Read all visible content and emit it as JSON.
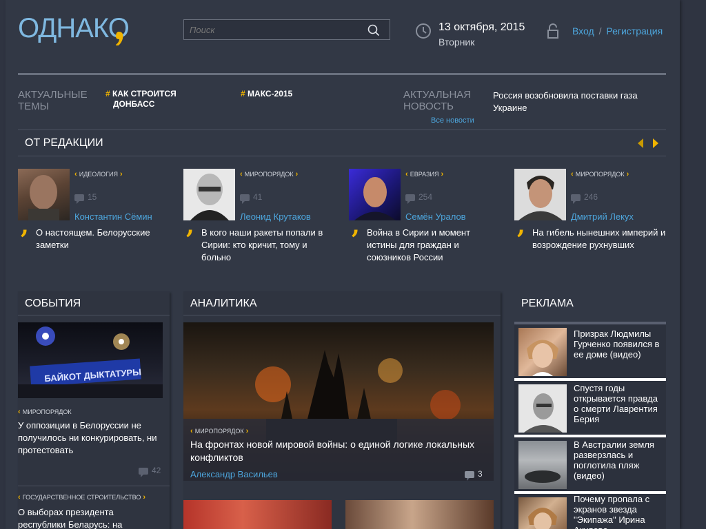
{
  "header": {
    "logo_text": "ОДНАКО",
    "search_placeholder": "Поиск",
    "date": "13 октября, 2015",
    "weekday": "Вторник",
    "login": "Вход",
    "separator": "/",
    "register": "Регистрация"
  },
  "topics": {
    "label_line1": "АКТУАЛЬНЫЕ",
    "label_line2": "ТЕМЫ",
    "items": [
      {
        "hash": "#",
        "line1": "КАК СТРОИТСЯ",
        "line2": "ДОНБАСС"
      },
      {
        "hash": "#",
        "line1": "МАКС-2015",
        "line2": ""
      }
    ]
  },
  "news": {
    "label_line1": "АКТУАЛЬНАЯ",
    "label_line2": "НОВОСТЬ",
    "text": "Россия возобновила поставки газа Украине",
    "all_news": "Все новости"
  },
  "editorial": {
    "title": "ОТ РЕДАКЦИИ",
    "cards": [
      {
        "tag": "ИДЕОЛОГИЯ",
        "comments": "15",
        "author": "Константин Сёмин",
        "title": "О настоящем. Белорусские заметки"
      },
      {
        "tag": "МИРОПОРЯДОК",
        "comments": "41",
        "author": "Леонид Крутаков",
        "title": "В кого наши ракеты попали в Сирии: кто кричит, тому и больно"
      },
      {
        "tag": "ЕВРАЗИЯ",
        "comments": "254",
        "author": "Семён Уралов",
        "title": "Война в Сирии и момент истины для граждан и союзников России"
      },
      {
        "tag": "МИРОПОРЯДОК",
        "comments": "246",
        "author": "Дмитрий Лекух",
        "title": "На гибель нынешних империй и возрождение рухнувших"
      }
    ]
  },
  "events": {
    "title": "СОБЫТИЯ",
    "photo_caption": "БАЙКОТ ДЫКТАТУРЫ",
    "items": [
      {
        "tag": "МИРОПОРЯДОК",
        "title": "У оппозиции в Белоруссии не получилось ни конкурировать, ни протестовать",
        "comments": "42"
      },
      {
        "tag": "ГОСУДАРСТВЕННОЕ СТРОИТЕЛЬСТВО",
        "title": "О выборах президента республики Беларусь: на"
      }
    ]
  },
  "analytics": {
    "title": "АНАЛИТИКА",
    "tag": "МИРОПОРЯДОК",
    "headline": "На фронтах новой мировой войны: о единой логике локальных конфликтов",
    "author": "Александр Васильев",
    "comments": "3"
  },
  "ads": {
    "title": "РЕКЛАМА",
    "items": [
      {
        "text": "Призрак Людмилы Гурченко появился в ее доме (видео)"
      },
      {
        "text": "Спустя годы открывается правда о смерти Лаврентия Берия"
      },
      {
        "text": "В Австралии земля разверзлась и поглотила пляж (видео)"
      },
      {
        "text": "Почему пропала с экранов звезда \"Экипажа\" Ирина Акулова"
      }
    ]
  },
  "colors": {
    "background": "#323845",
    "accent_yellow": "#f0b400",
    "link_blue": "#4da6dd",
    "logo_blue": "#7fb8e0",
    "panel": "#2a2f3b"
  }
}
